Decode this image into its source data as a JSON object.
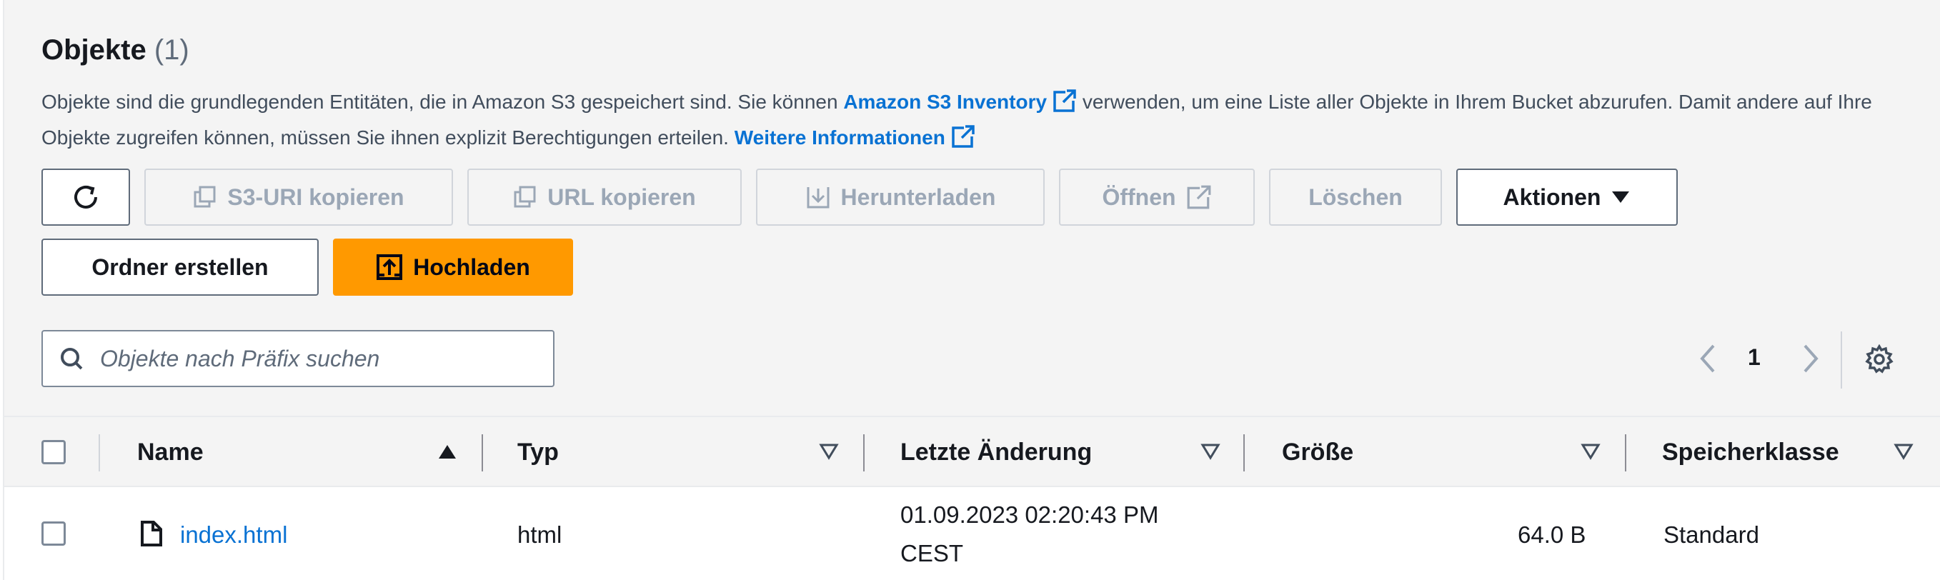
{
  "header": {
    "title": "Objekte",
    "count": "(1)",
    "description_part1": "Objekte sind die grundlegenden Entitäten, die in Amazon S3 gespeichert sind. Sie können ",
    "inventory_link": "Amazon S3 Inventory",
    "description_part2": " verwenden, um eine Liste aller Objekte in Ihrem Bucket abzurufen. Damit andere auf Ihre Objekte zugreifen können, müssen Sie ihnen explizit Berechtigungen erteilen. ",
    "learn_more_link": "Weitere Informationen"
  },
  "toolbar": {
    "copy_s3_uri": "S3-URI kopieren",
    "copy_url": "URL kopieren",
    "download": "Herunterladen",
    "open": "Öffnen",
    "delete": "Löschen",
    "actions": "Aktionen",
    "create_folder": "Ordner erstellen",
    "upload": "Hochladen"
  },
  "search": {
    "placeholder": "Objekte nach Präfix suchen"
  },
  "pagination": {
    "current_page": "1"
  },
  "table": {
    "columns": [
      "Name",
      "Typ",
      "Letzte Änderung",
      "Größe",
      "Speicherklasse"
    ],
    "rows": [
      {
        "name": "index.html",
        "type": "html",
        "modified_line1": "01.09.2023 02:20:43 PM",
        "modified_line2": "CEST",
        "size": "64.0 B",
        "storage_class": "Standard"
      }
    ]
  },
  "colors": {
    "link": "#0972d3",
    "primary": "#ff9900",
    "disabled_text": "#9ba7b6"
  },
  "icons": [
    "refresh-icon",
    "copy-icon",
    "download-icon",
    "external-link-icon",
    "caret-down-icon",
    "upload-icon",
    "search-icon",
    "chevron-left-icon",
    "chevron-right-icon",
    "settings-icon",
    "sort-ascending-icon",
    "sort-icon",
    "file-icon"
  ]
}
